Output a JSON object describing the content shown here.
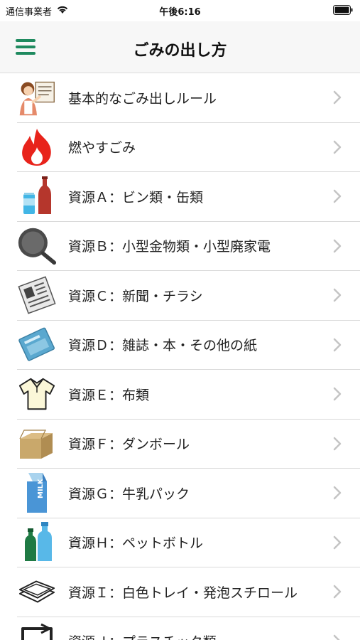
{
  "status_bar": {
    "carrier": "通信事業者",
    "time": "午後6:16"
  },
  "header": {
    "title": "ごみの出し方",
    "menu_icon": "hamburger-menu-icon",
    "accent_color": "#1f8a5f"
  },
  "list": {
    "items": [
      {
        "label": "基本的なごみ出しルール",
        "icon": "person-with-board-icon"
      },
      {
        "label": "燃やすごみ",
        "icon": "flame-icon"
      },
      {
        "label": "資源Ａ：ビン類・缶類",
        "icon": "can-and-bottle-icon"
      },
      {
        "label": "資源Ｂ：小型金物類・小型廃家電",
        "icon": "frying-pan-icon"
      },
      {
        "label": "資源Ｃ：新聞・チラシ",
        "icon": "newspaper-icon"
      },
      {
        "label": "資源Ｄ：雑誌・本・その他の紙",
        "icon": "magazine-icon"
      },
      {
        "label": "資源Ｅ：布類",
        "icon": "shirt-icon"
      },
      {
        "label": "資源Ｆ：ダンボール",
        "icon": "cardboard-box-icon"
      },
      {
        "label": "資源Ｇ：牛乳パック",
        "icon": "milk-carton-icon"
      },
      {
        "label": "資源Ｈ：ペットボトル",
        "icon": "pet-bottles-icon"
      },
      {
        "label": "資源Ｉ：白色トレイ・発泡スチロール",
        "icon": "food-tray-icon"
      },
      {
        "label": "資源Ｊ：プラスチック類",
        "icon": "plastic-recycle-icon"
      }
    ]
  }
}
